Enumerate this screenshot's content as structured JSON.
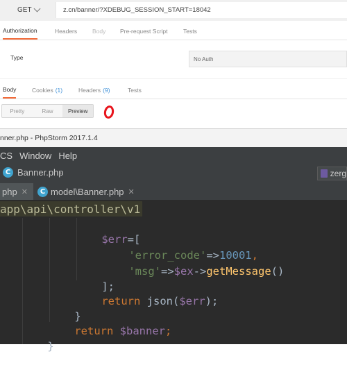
{
  "postman": {
    "method": "GET",
    "url": "z.cn/banner/?XDEBUG_SESSION_START=18042",
    "request_tabs": [
      {
        "label": "Authorization",
        "active": true
      },
      {
        "label": "Headers",
        "active": false
      },
      {
        "label": "Body",
        "active": false
      },
      {
        "label": "Pre-request Script",
        "active": false
      },
      {
        "label": "Tests",
        "active": false
      }
    ],
    "type_label": "Type",
    "auth_value": "No Auth",
    "response_tabs": [
      {
        "label": "Body",
        "count": "",
        "active": true
      },
      {
        "label": "Cookies",
        "count": "(1)",
        "active": false
      },
      {
        "label": "Headers",
        "count": "(9)",
        "active": false
      },
      {
        "label": "Tests",
        "count": "",
        "active": false
      }
    ],
    "view_buttons": [
      "Pretty",
      "Raw",
      "Preview"
    ],
    "view_active": "Preview",
    "accent_color": "#f26b3a",
    "annotation_color": "#e8141c"
  },
  "phpstorm": {
    "title": "nner.php - PhpStorm 2017.1.4",
    "menu": [
      "CS",
      "Window",
      "Help"
    ],
    "nav_file": "Banner.php",
    "nav_right": "zerg",
    "file_tabs": [
      {
        "label": "php",
        "icon": "php-class-icon"
      },
      {
        "label": "model\\Banner.php",
        "icon": "php-class-icon"
      }
    ],
    "breadcrumb": "app\\api\\controller\\v1",
    "code": {
      "l1_var": "$err",
      "l1_rest": "=[",
      "l2_str": "'error_code'",
      "l2_op": "=>",
      "l2_num": "10001",
      "l2_end": ",",
      "l3_str": "'msg'",
      "l3_op": "=>",
      "l3_var": "$ex",
      "l3_arrow": "->",
      "l3_fn": "getMessage",
      "l3_end": "()",
      "l4": "];",
      "l5_kw": "return",
      "l5_fn": " json(",
      "l5_var": "$err",
      "l5_end": ");",
      "l6": "}",
      "l7_kw": "return",
      "l7_var": " $banner",
      "l7_end": ";",
      "l8": "}"
    }
  }
}
